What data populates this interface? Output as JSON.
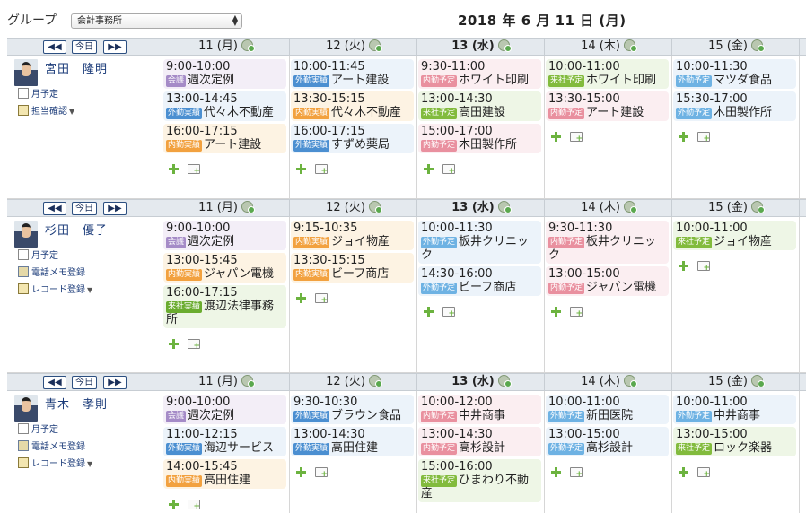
{
  "toolbar": {
    "group_label": "グループ",
    "group_select": "会計事務所",
    "date_title": "2018 年 6 月 11 日 (月)"
  },
  "nav": {
    "prev": "◀◀",
    "today": "今日",
    "next": "▶▶"
  },
  "days": [
    {
      "label": "11 (月)",
      "today": false
    },
    {
      "label": "12 (火)",
      "today": false
    },
    {
      "label": "13 (水)",
      "today": true
    },
    {
      "label": "14 (木)",
      "today": false
    },
    {
      "label": "15 (金)",
      "today": false
    }
  ],
  "users": [
    {
      "name": "宮田　隆明",
      "links": [
        {
          "label": "月予定",
          "icon": "calendar-icon"
        },
        {
          "label": "担当確認",
          "icon": "check-icon",
          "caret": true
        }
      ],
      "days": [
        [
          {
            "time": "9:00-10:00",
            "tag": "会議",
            "tagclass": "kaigi",
            "title": "週次定例",
            "color": "purple"
          },
          {
            "time": "13:00-14:45",
            "tag": "外勤実績",
            "tagclass": "gaidou-jisseki",
            "title": "代々木不動産",
            "color": "blue"
          },
          {
            "time": "16:00-17:15",
            "tag": "内勤実績",
            "tagclass": "naidou-jisseki",
            "title": "アート建設",
            "color": "orange"
          }
        ],
        [
          {
            "time": "10:00-11:45",
            "tag": "外勤実績",
            "tagclass": "gaidou-jisseki",
            "title": "アート建設",
            "color": "blue"
          },
          {
            "time": "13:30-15:15",
            "tag": "内勤実績",
            "tagclass": "naidou-jisseki",
            "title": "代々木不動産",
            "color": "orange"
          },
          {
            "time": "16:00-17:15",
            "tag": "外勤実績",
            "tagclass": "gaidou-jisseki",
            "title": "すずめ薬局",
            "color": "blue"
          }
        ],
        [
          {
            "time": "9:30-11:00",
            "tag": "内勤予定",
            "tagclass": "naidou-yotei",
            "title": "ホワイト印刷",
            "color": "pink"
          },
          {
            "time": "13:00-14:30",
            "tag": "来社予定",
            "tagclass": "raisha-yotei",
            "title": "高田建設",
            "color": "green"
          },
          {
            "time": "15:00-17:00",
            "tag": "内勤予定",
            "tagclass": "naidou-yotei",
            "title": "木田製作所",
            "color": "pink"
          }
        ],
        [
          {
            "time": "10:00-11:00",
            "tag": "来社予定",
            "tagclass": "raisha-yotei",
            "title": "ホワイト印刷",
            "color": "green"
          },
          {
            "time": "13:30-15:00",
            "tag": "内勤予定",
            "tagclass": "naidou-yotei",
            "title": "アート建設",
            "color": "pink"
          }
        ],
        [
          {
            "time": "10:00-11:30",
            "tag": "外勤予定",
            "tagclass": "gaidou-yotei",
            "title": "マツダ食品",
            "color": "blue"
          },
          {
            "time": "15:30-17:00",
            "tag": "外勤予定",
            "tagclass": "gaidou-yotei",
            "title": "木田製作所",
            "color": "blue"
          }
        ]
      ]
    },
    {
      "name": "杉田　優子",
      "links": [
        {
          "label": "月予定",
          "icon": "calendar-icon"
        },
        {
          "label": "電話メモ登録",
          "icon": "memo-icon"
        },
        {
          "label": "レコード登録",
          "icon": "check-icon",
          "caret": true
        }
      ],
      "days": [
        [
          {
            "time": "9:00-10:00",
            "tag": "会議",
            "tagclass": "kaigi",
            "title": "週次定例",
            "color": "purple"
          },
          {
            "time": "13:00-15:45",
            "tag": "内勤実績",
            "tagclass": "naidou-jisseki",
            "title": "ジャパン電機",
            "color": "orange"
          },
          {
            "time": "16:00-17:15",
            "tag": "来社実績",
            "tagclass": "raisha-jisseki",
            "title": "渡辺法律事務所",
            "color": "green"
          }
        ],
        [
          {
            "time": "9:15-10:35",
            "tag": "内勤実績",
            "tagclass": "naidou-jisseki",
            "title": "ジョイ物産",
            "color": "orange"
          },
          {
            "time": "13:30-15:15",
            "tag": "内勤実績",
            "tagclass": "naidou-jisseki",
            "title": "ビーフ商店",
            "color": "orange"
          }
        ],
        [
          {
            "time": "10:00-11:30",
            "tag": "外勤予定",
            "tagclass": "gaidou-yotei",
            "title": "板井クリニック",
            "color": "blue"
          },
          {
            "time": "14:30-16:00",
            "tag": "外勤予定",
            "tagclass": "gaidou-yotei",
            "title": "ビーフ商店",
            "color": "blue"
          }
        ],
        [
          {
            "time": "9:30-11:30",
            "tag": "内勤予定",
            "tagclass": "naidou-yotei",
            "title": "板井クリニック",
            "color": "pink"
          },
          {
            "time": "13:00-15:00",
            "tag": "内勤予定",
            "tagclass": "naidou-yotei",
            "title": "ジャパン電機",
            "color": "pink"
          }
        ],
        [
          {
            "time": "10:00-11:00",
            "tag": "来社予定",
            "tagclass": "raisha-yotei",
            "title": "ジョイ物産",
            "color": "green"
          }
        ]
      ]
    },
    {
      "name": "青木　孝則",
      "links": [
        {
          "label": "月予定",
          "icon": "calendar-icon"
        },
        {
          "label": "電話メモ登録",
          "icon": "memo-icon"
        },
        {
          "label": "レコード登録",
          "icon": "check-icon",
          "caret": true
        }
      ],
      "days": [
        [
          {
            "time": "9:00-10:00",
            "tag": "会議",
            "tagclass": "kaigi",
            "title": "週次定例",
            "color": "purple"
          },
          {
            "time": "11:00-12:15",
            "tag": "外勤実績",
            "tagclass": "gaidou-jisseki",
            "title": "海辺サービス",
            "color": "blue"
          },
          {
            "time": "14:00-15:45",
            "tag": "内勤実績",
            "tagclass": "naidou-jisseki",
            "title": "高田住建",
            "color": "orange"
          }
        ],
        [
          {
            "time": "9:30-10:30",
            "tag": "外勤実績",
            "tagclass": "gaidou-jisseki",
            "title": "ブラウン食品",
            "color": "blue"
          },
          {
            "time": "13:00-14:30",
            "tag": "外勤実績",
            "tagclass": "gaidou-jisseki",
            "title": "高田住建",
            "color": "blue"
          }
        ],
        [
          {
            "time": "10:00-12:00",
            "tag": "内勤予定",
            "tagclass": "naidou-yotei",
            "title": "中井商事",
            "color": "pink"
          },
          {
            "time": "13:00-14:30",
            "tag": "内勤予定",
            "tagclass": "naidou-yotei",
            "title": "高杉設計",
            "color": "pink"
          },
          {
            "time": "15:00-16:00",
            "tag": "来社予定",
            "tagclass": "raisha-yotei",
            "title": "ひまわり不動産",
            "color": "green"
          }
        ],
        [
          {
            "time": "10:00-11:00",
            "tag": "外勤予定",
            "tagclass": "gaidou-yotei",
            "title": "新田医院",
            "color": "blue"
          },
          {
            "time": "13:00-15:00",
            "tag": "外勤予定",
            "tagclass": "gaidou-yotei",
            "title": "高杉設計",
            "color": "blue"
          }
        ],
        [
          {
            "time": "10:00-11:00",
            "tag": "外勤予定",
            "tagclass": "gaidou-yotei",
            "title": "中井商事",
            "color": "blue"
          },
          {
            "time": "13:00-15:00",
            "tag": "来社予定",
            "tagclass": "raisha-yotei",
            "title": "ロック楽器",
            "color": "green"
          }
        ]
      ]
    }
  ]
}
